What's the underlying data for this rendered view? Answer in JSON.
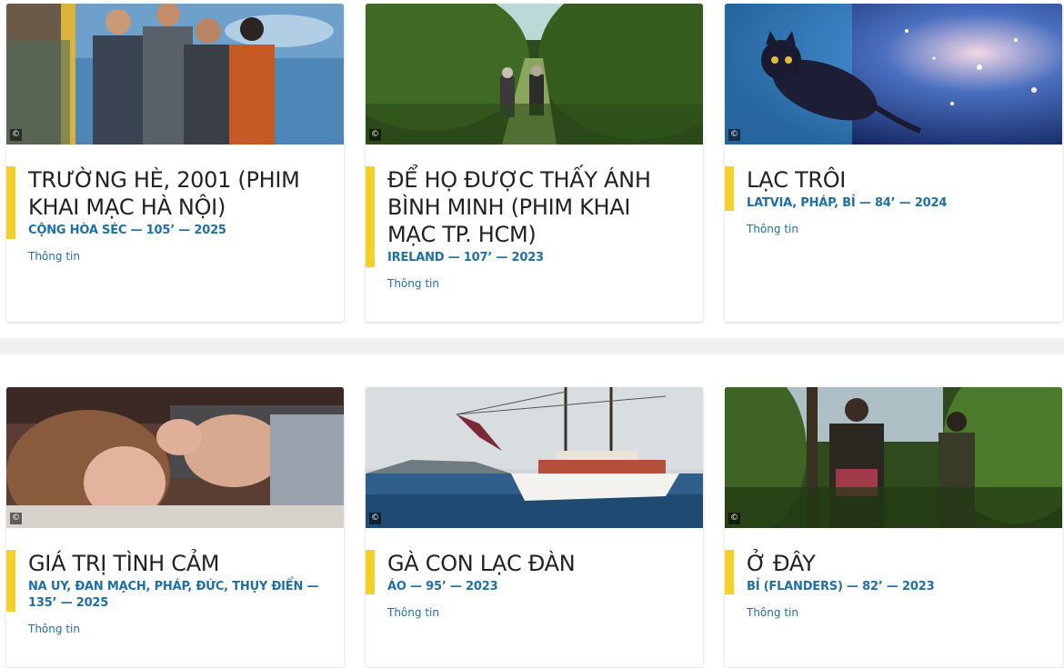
{
  "copyright_symbol": "©",
  "films": [
    {
      "title": "TRƯỜNG HÈ, 2001 (PHIM KHAI MẠC HÀ NỘI)",
      "meta": "CỘNG HÒA SÉC — 105’ — 2025",
      "link": "Thông tin"
    },
    {
      "title": "ĐỂ HỌ ĐƯỢC THẤY ÁNH BÌNH MINH (PHIM KHAI MẠC TP. HCM)",
      "meta": "IRELAND — 107’ — 2023",
      "link": "Thông tin"
    },
    {
      "title": "LẠC TRÔI",
      "meta": "LATVIA, PHÁP, BỈ — 84’ — 2024",
      "link": "Thông tin"
    },
    {
      "title": "GIÁ TRỊ TÌNH CẢM",
      "meta": "NA UY, ĐAN MẠCH, PHÁP, ĐỨC, THỤY ĐIỂN — 135’ — 2025",
      "link": "Thông tin"
    },
    {
      "title": "GÀ CON LẠC ĐÀN",
      "meta": "ÁO — 95’ — 2023",
      "link": "Thông tin"
    },
    {
      "title": "Ở ĐÂY",
      "meta": "BỈ (FLANDERS) — 82’ — 2023",
      "link": "Thông tin"
    }
  ],
  "colors": {
    "accent": "#f5d026",
    "meta": "#1e6fa8",
    "title": "#222222",
    "band": "#f0f0f0"
  }
}
